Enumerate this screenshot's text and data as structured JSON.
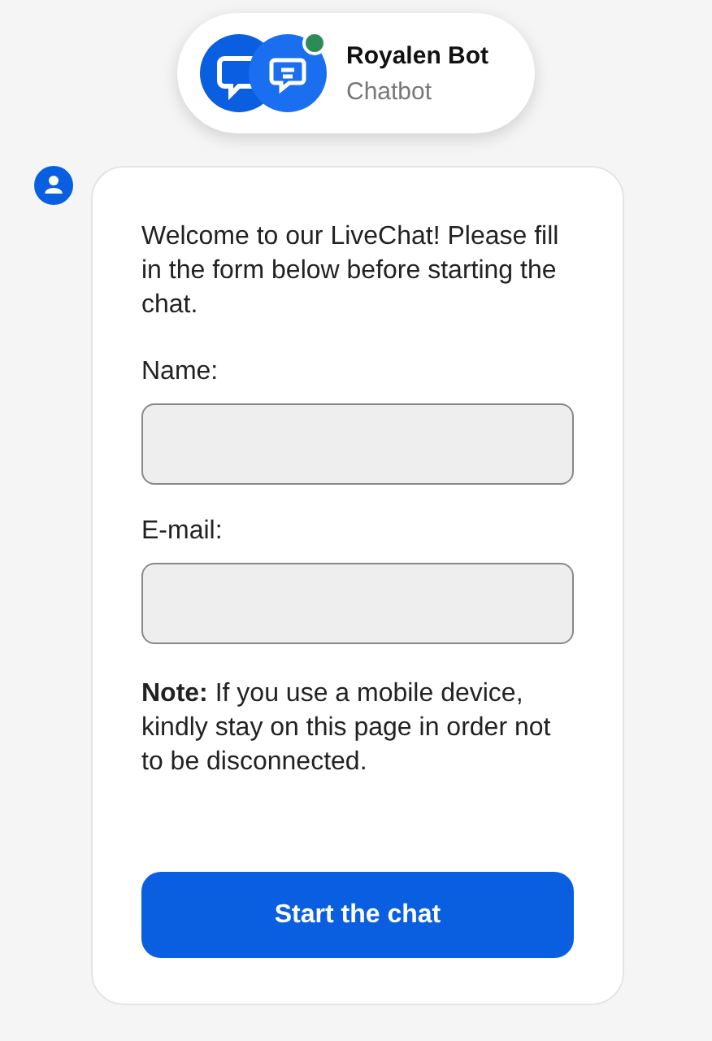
{
  "header": {
    "name": "Royalen Bot",
    "subtitle": "Chatbot",
    "online": true
  },
  "message": {
    "intro": "Welcome to our LiveChat! Please fill in the form below before starting the chat.",
    "fields": [
      {
        "label": "Name:"
      },
      {
        "label": "E-mail:"
      }
    ],
    "note": "**Note:** If you use a mobile device, kindly stay on this page in order not to be disconnected.",
    "button": "Start the chat"
  }
}
